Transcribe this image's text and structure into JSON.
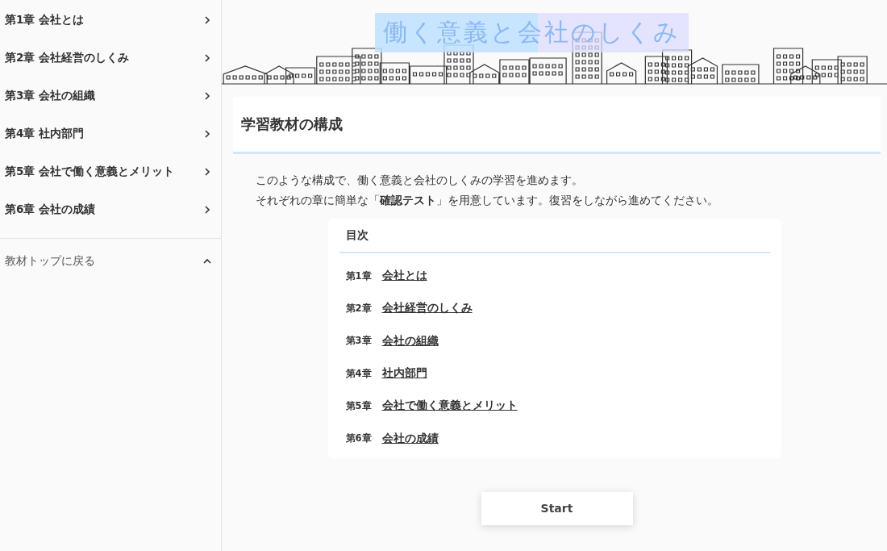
{
  "sidebar": {
    "items": [
      {
        "label": "第1章 会社とは"
      },
      {
        "label": "第2章 会社経営のしくみ"
      },
      {
        "label": "第3章 会社の組織"
      },
      {
        "label": "第4章 社内部門"
      },
      {
        "label": "第5章 会社で働く意義とメリット"
      },
      {
        "label": "第6章 会社の成績"
      }
    ],
    "back": {
      "label": "教材トップに戻る"
    }
  },
  "header": {
    "title": "働く意義と会社のしくみ"
  },
  "section": {
    "heading": "学習教材の構成",
    "intro": [
      "このような構成で、働く意義と会社のしくみの学習を進めます。",
      "それぞれの章に簡単な「**確認テスト**」を用意しています。復習をしながら進めてください。"
    ]
  },
  "toc": {
    "title": "目次",
    "items": [
      {
        "chapter": "第1章",
        "title": "会社とは"
      },
      {
        "chapter": "第2章",
        "title": "会社経営のしくみ"
      },
      {
        "chapter": "第3章",
        "title": "会社の組織"
      },
      {
        "chapter": "第4章",
        "title": "社内部門"
      },
      {
        "chapter": "第5章",
        "title": "会社で働く意義とメリット"
      },
      {
        "chapter": "第6章",
        "title": "会社の成績"
      }
    ]
  },
  "start_button": "Start"
}
